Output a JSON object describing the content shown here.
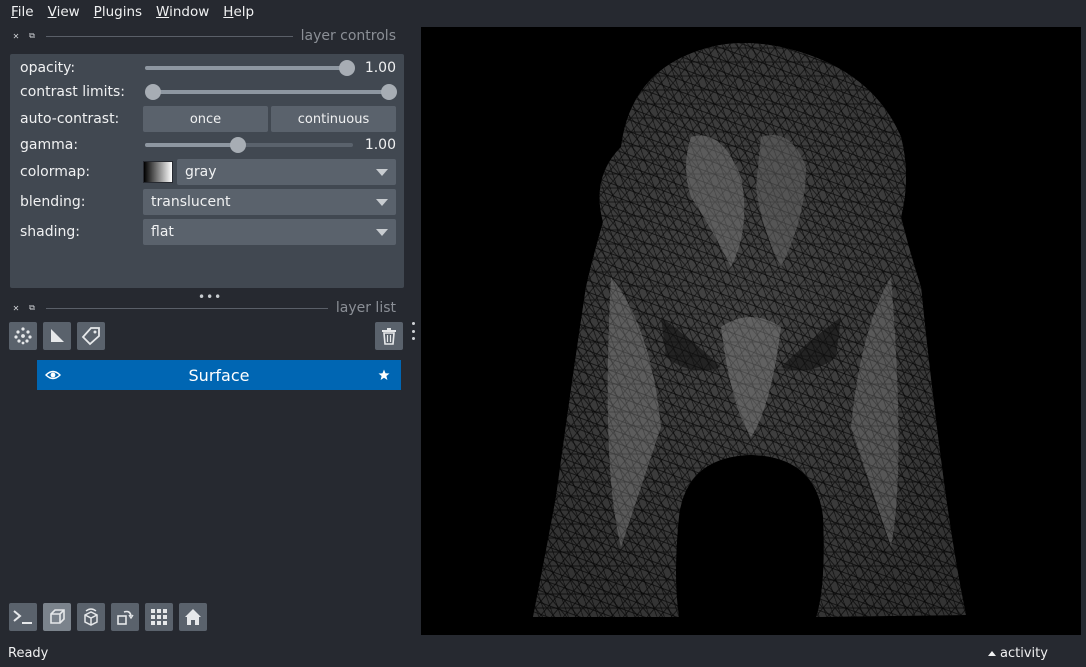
{
  "menu": [
    {
      "key": "F",
      "rest": "ile"
    },
    {
      "key": "V",
      "rest": "iew"
    },
    {
      "key": "P",
      "rest": "lugins"
    },
    {
      "key": "W",
      "rest": "indow"
    },
    {
      "key": "H",
      "rest": "elp"
    }
  ],
  "layer_controls": {
    "title": "layer controls",
    "opacity": {
      "label": "opacity:",
      "value": "1.00",
      "level": 1.0
    },
    "contrast_limits": {
      "label": "contrast limits:",
      "low": 0.0,
      "high": 1.0
    },
    "auto_contrast": {
      "label": "auto-contrast:",
      "once": "once",
      "continuous": "continuous"
    },
    "gamma": {
      "label": "gamma:",
      "value": "1.00",
      "level": 0.45
    },
    "colormap": {
      "label": "colormap:",
      "value": "gray"
    },
    "blending": {
      "label": "blending:",
      "value": "translucent"
    },
    "shading": {
      "label": "shading:",
      "value": "flat"
    }
  },
  "layer_list": {
    "title": "layer list",
    "layers": [
      {
        "name": "Surface",
        "visible": true
      }
    ]
  },
  "status": {
    "text": "Ready",
    "activity": "activity"
  },
  "colors": {
    "selected_layer": "#0066b3",
    "background": "#262930",
    "panel": "#414851"
  }
}
